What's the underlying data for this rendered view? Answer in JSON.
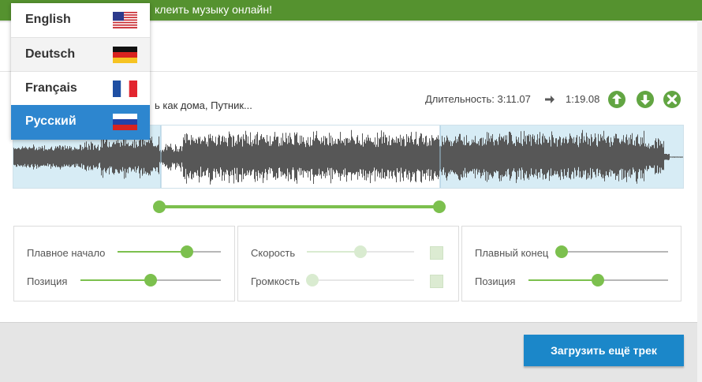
{
  "topbar": {
    "text": "клеить музыку онлайн!"
  },
  "track": {
    "title": "ь как дома, Путник..."
  },
  "duration": {
    "label": "Длительность: 3:11.07",
    "new_value": "1:19.08"
  },
  "colors": {
    "green": "#55922f",
    "accent_green": "#7cc04e",
    "blue": "#1b87c9",
    "selection": "#d7ecf5",
    "wave": "#575757"
  },
  "icons": {
    "move_up": "arrow-up-circle-icon",
    "move_down": "arrow-down-circle-icon",
    "remove": "close-circle-icon",
    "arrow": "arrow-right-icon"
  },
  "selection": {
    "start_fraction": 0.22,
    "end_fraction": 0.637
  },
  "panels": {
    "fade_in": {
      "label": "Плавное начало",
      "value": 0.7
    },
    "position_left": {
      "label": "Позиция",
      "value": 0.5
    },
    "speed": {
      "label": "Скорость",
      "value": 0.5
    },
    "volume": {
      "label": "Громкость",
      "value": 0.05
    },
    "fade_out": {
      "label": "Плавный конец",
      "value": 0.0
    },
    "position_right": {
      "label": "Позиция",
      "value": 0.5
    }
  },
  "upload_button": {
    "label": "Загрузить ещё трек"
  },
  "languages": [
    {
      "label": "English",
      "flag": "us-flag-icon"
    },
    {
      "label": "Deutsch",
      "flag": "de-flag-icon"
    },
    {
      "label": "Français",
      "flag": "fr-flag-icon"
    },
    {
      "label": "Русский",
      "flag": "ru-flag-icon",
      "selected": true
    }
  ]
}
